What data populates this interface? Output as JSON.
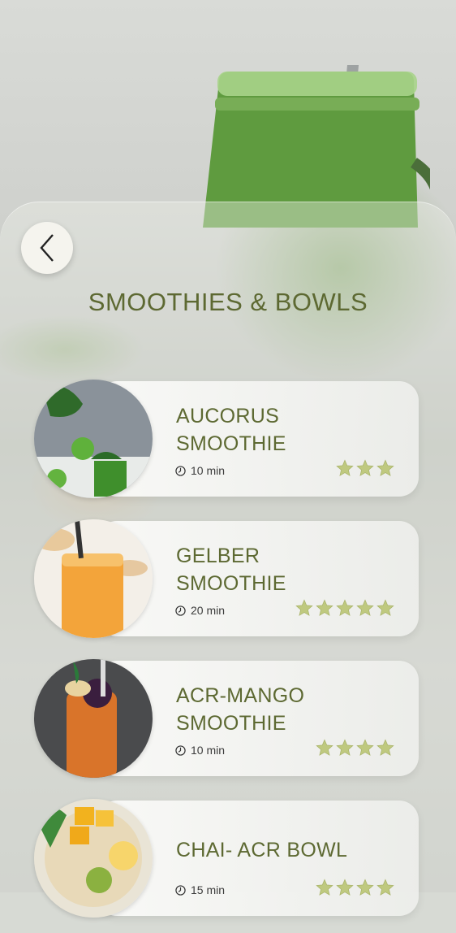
{
  "header": {
    "title": "SMOOTHIES & BOWLS"
  },
  "back_button": {
    "icon": "chevron-left-icon"
  },
  "recipes": [
    {
      "name_line1": "AUCORUS",
      "name_line2": "SMOOTHIE",
      "time": "10 min",
      "rating": 3
    },
    {
      "name_line1": "GELBER",
      "name_line2": "SMOOTHIE",
      "time": "20 min",
      "rating": 5
    },
    {
      "name_line1": "ACR-MANGO",
      "name_line2": "SMOOTHIE",
      "time": "10 min",
      "rating": 4
    },
    {
      "name_line1": "CHAI- ACR BOWL",
      "name_line2": "",
      "time": "15 min",
      "rating": 4
    }
  ],
  "colors": {
    "accent": "#5d6932",
    "star": "#bfc97f"
  }
}
